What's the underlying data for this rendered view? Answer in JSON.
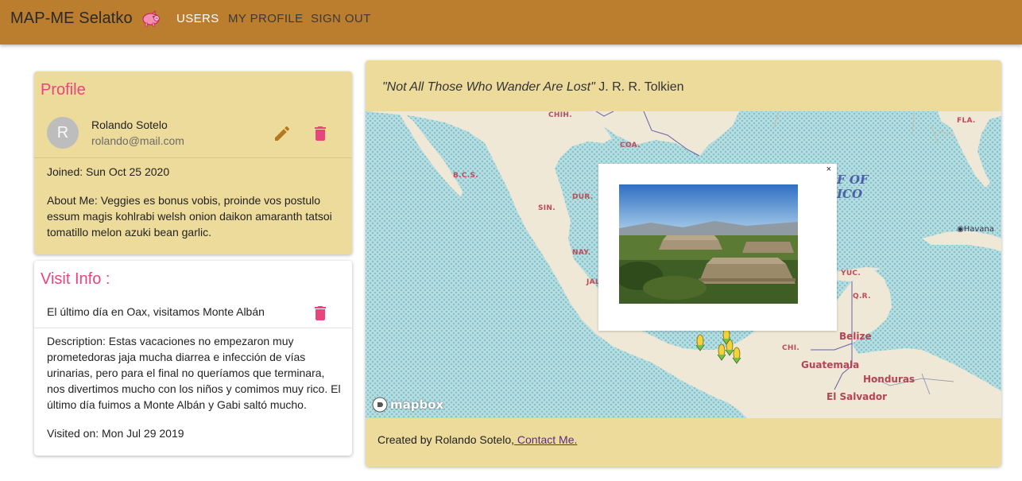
{
  "appbar": {
    "brand": "MAP-ME Selatko",
    "nav": {
      "users": "USERS",
      "my_profile": "MY PROFILE",
      "sign_out": "SIGN OUT"
    },
    "color": "#bb7d2e"
  },
  "profile": {
    "title": "Profile",
    "avatar_letter": "R",
    "name": "Rolando Sotelo",
    "email": "rolando@mail.com",
    "joined": "Joined: Sun Oct 25 2020",
    "about": "About Me: Veggies es bonus vobis, proinde vos postulo essum magis kohlrabi welsh onion daikon amaranth tatsoi tomatillo melon azuki bean garlic.",
    "accent_color": "#e8457c",
    "card_color": "#eddb9b"
  },
  "visit": {
    "title": "Visit Info :",
    "heading": "El último día en Oax, visitamos Monte Albán",
    "description": "Description: Estas vacaciones no empezaron muy prometedoras jaja mucha diarrea e infección de vías urinarias, pero para el final no queríamos que terminara, nos divertimos mucho con los niños y comimos muy rico. El último día fuimos a Monte Albán y Gabi saltó mucho.",
    "visited_on": "Visited on: Mon Jul 29 2019"
  },
  "map_card": {
    "quote_italic": "\"Not All Those Who Wander Are Lost\"",
    "quote_author": " J. R. R. Tolkien",
    "popup_close": "×",
    "attribution": "mapbox",
    "labels": {
      "chih": "CHIH.",
      "coa": "COA.",
      "bcs": "B.C.S.",
      "dur": "DUR.",
      "sin": "SIN.",
      "nay": "NAY.",
      "jal": "JAL",
      "yuc": "YUC.",
      "qr": "Q.R.",
      "chi": "CHI.",
      "fla": "FLA."
    },
    "gulf_line1": "F OF",
    "gulf_line2": "ICO",
    "countries": {
      "belize": "Belize",
      "guatemala": "Guatemala",
      "honduras": "Honduras",
      "el_salvador": "El Salvador"
    },
    "cities": {
      "havana": "Havana"
    }
  },
  "footer": {
    "created_by": "Created by Rolando Sotelo,",
    "contact": " Contact Me."
  },
  "icons": {
    "logo": "pig-icon",
    "edit": "pencil-icon",
    "delete": "trash-icon",
    "marker": "corn-marker-icon",
    "close": "close-icon"
  }
}
